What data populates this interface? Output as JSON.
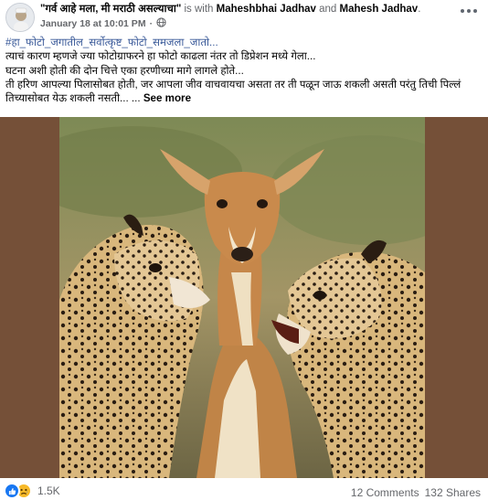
{
  "post": {
    "page_name": "\"गर्व आहे मला, मी मराठी असल्याचा\"",
    "with_text": "is with",
    "tagged_1": "Maheshbhai Jadhav",
    "and_text": "and",
    "tagged_2": "Mahesh Jadhav",
    "period": ".",
    "timestamp": "January 18 at 10:01 PM",
    "separator": "·",
    "audience_icon": "globe-icon",
    "more_icon": "more-options-icon",
    "text_lines": [
      "#हा_फोटो_जगातील_सर्वोत्कृष्ट_फोटो_समजला_जातो...",
      "त्याचं कारण म्हणजे ज्या फोटोग्राफरने हा फोटो काढला नंतर तो डिप्रेशन मध्ये गेला...",
      "घटना अशी होती की दोन चित्ते एका हरणीच्या मागे लागले होते...",
      "ती हरिण आपल्या पिलासोबत होती, जर आपला जीव वाचवायचा असता तर ती पळून जाऊ शकली असती परंतु तिची पिल्लं",
      "तिच्यासोबत येऊ शकली नसती... ..."
    ],
    "see_more": "See more",
    "image_alt": "Two cheetahs holding an impala",
    "footer": {
      "reaction_icons": [
        "like-icon",
        "sad-icon"
      ],
      "reaction_count": "1.5K",
      "comments": "12 Comments",
      "shares": "132 Shares"
    },
    "colors": {
      "link_blue": "#385898",
      "like_blue": "#1877f2",
      "sad_yellow": "#f7b928",
      "muted_gray": "#65676b",
      "photo_border_brown": "#755038"
    }
  }
}
